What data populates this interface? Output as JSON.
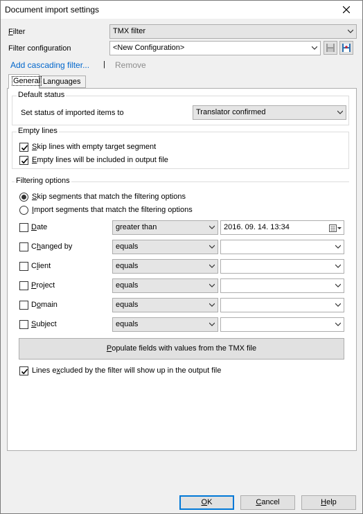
{
  "window": {
    "title": "Document import settings"
  },
  "filter": {
    "label": "Filter",
    "access_key": "F",
    "label_rest": "ilter",
    "value": "TMX filter"
  },
  "filter_configuration": {
    "label": "Filter configuration",
    "value": "<New Configuration>"
  },
  "actions": {
    "add_cascading": "Add cascading filter...",
    "separator": "|",
    "remove": "Remove"
  },
  "tabs": [
    {
      "label": "General"
    },
    {
      "label": "Languages"
    }
  ],
  "default_status": {
    "title": "Default status",
    "label": "Set status of imported items to",
    "value": "Translator confirmed"
  },
  "empty_lines": {
    "title": "Empty lines",
    "options": [
      {
        "key": "S",
        "rest": "kip lines with empty target segment",
        "checked": true
      },
      {
        "key": "E",
        "rest": "mpty lines will be included in output file",
        "checked": true
      }
    ]
  },
  "filtering_options": {
    "title": "Filtering options",
    "radios": [
      {
        "key": "S",
        "rest": "kip segments that match the filtering options",
        "selected": true
      },
      {
        "key": "I",
        "rest": "mport segments that match the filtering options",
        "selected": false
      }
    ],
    "rows": [
      {
        "pre": "",
        "key": "D",
        "post": "ate",
        "operator": "greater than",
        "value": "2016. 09. 14. 13:34",
        "checked": false
      },
      {
        "pre": "C",
        "key": "h",
        "post": "anged by",
        "operator": "equals",
        "value": "",
        "checked": false
      },
      {
        "pre": "C",
        "key": "l",
        "post": "ient",
        "operator": "equals",
        "value": "",
        "checked": false
      },
      {
        "pre": "",
        "key": "P",
        "post": "roject",
        "operator": "equals",
        "value": "",
        "checked": false
      },
      {
        "pre": "D",
        "key": "o",
        "post": "main",
        "operator": "equals",
        "value": "",
        "checked": false
      },
      {
        "pre": "",
        "key": "S",
        "post": "ubject",
        "operator": "equals",
        "value": "",
        "checked": false
      }
    ],
    "populate_key": "P",
    "populate_rest": "opulate fields with values from the TMX file",
    "excluded_pre": "Lines e",
    "excluded_key": "x",
    "excluded_post": "cluded by the filter will show up in the output file",
    "excluded_checked": true
  },
  "buttons": {
    "ok_key": "O",
    "ok_rest": "K",
    "cancel_key": "C",
    "cancel_rest": "ancel",
    "help_key": "H",
    "help_rest": "elp"
  }
}
